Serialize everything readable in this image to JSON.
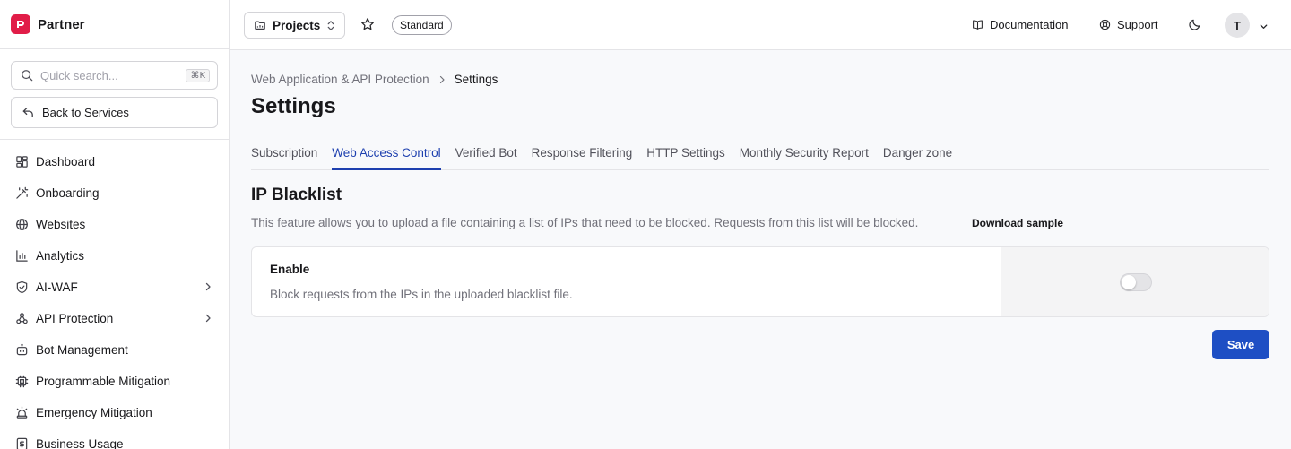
{
  "sidebar": {
    "brand": "Partner",
    "search": {
      "placeholder": "Quick search...",
      "shortcut": "⌘K"
    },
    "back_label": "Back to Services",
    "items": [
      {
        "label": "Dashboard",
        "icon": "dashboard-icon"
      },
      {
        "label": "Onboarding",
        "icon": "wand-icon"
      },
      {
        "label": "Websites",
        "icon": "globe-icon"
      },
      {
        "label": "Analytics",
        "icon": "bar-chart-icon"
      },
      {
        "label": "AI-WAF",
        "icon": "shield-icon",
        "has_submenu": true
      },
      {
        "label": "API Protection",
        "icon": "webhook-icon",
        "has_submenu": true
      },
      {
        "label": "Bot Management",
        "icon": "bot-icon"
      },
      {
        "label": "Programmable Mitigation",
        "icon": "cpu-icon"
      },
      {
        "label": "Emergency Mitigation",
        "icon": "siren-icon"
      },
      {
        "label": "Business Usage",
        "icon": "dollar-icon"
      }
    ]
  },
  "topbar": {
    "projects_label": "Projects",
    "plan_badge": "Standard",
    "documentation_label": "Documentation",
    "support_label": "Support",
    "avatar_initial": "T"
  },
  "breadcrumb": {
    "parent": "Web Application & API Protection",
    "current": "Settings"
  },
  "page_title": "Settings",
  "tabs": [
    {
      "label": "Subscription",
      "active": false
    },
    {
      "label": "Web Access Control",
      "active": true
    },
    {
      "label": "Verified Bot",
      "active": false
    },
    {
      "label": "Response Filtering",
      "active": false
    },
    {
      "label": "HTTP Settings",
      "active": false
    },
    {
      "label": "Monthly Security Report",
      "active": false
    },
    {
      "label": "Danger zone",
      "active": false
    }
  ],
  "section": {
    "title": "IP Blacklist",
    "description": "This feature allows you to upload a file containing a list of IPs that need to be blocked. Requests from this list will be blocked.",
    "download_label": "Download sample"
  },
  "enable_card": {
    "label": "Enable",
    "description": "Block requests from the IPs in the uploaded blacklist file.",
    "enabled": false
  },
  "save_label": "Save",
  "colors": {
    "accent": "#1e40af",
    "save_button": "#1e4fc4",
    "brand": "#e11d48"
  }
}
